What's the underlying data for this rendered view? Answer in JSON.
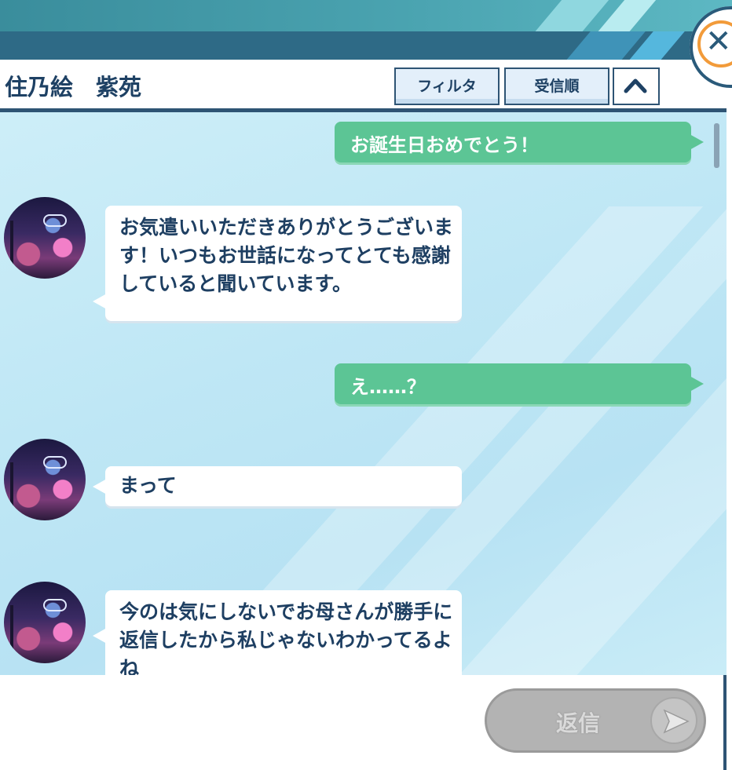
{
  "header": {
    "contact_name": "住乃絵　紫苑",
    "filter_label": "フィルタ",
    "sort_label": "受信順",
    "collapse_icon": "chevron-up-icon",
    "close_icon": "close-icon"
  },
  "messages": [
    {
      "from": "self",
      "text": "お誕生日おめでとう！"
    },
    {
      "from": "contact",
      "text": "お気遣いいただきありがとうございます！いつもお世話になってとても感謝していると聞いています。"
    },
    {
      "from": "self",
      "text": "え……？"
    },
    {
      "from": "contact",
      "text": "まって"
    },
    {
      "from": "contact",
      "text": "今のは気にしないでお母さんが勝手に返信したから私じゃないわかってるよね"
    }
  ],
  "footer": {
    "reply_label": "返信",
    "send_icon": "send-icon"
  },
  "colors": {
    "outgoing_bubble": "#5cc595",
    "incoming_bubble": "#ffffff",
    "accent": "#2e5474",
    "close_ring": "#f29b3a"
  }
}
